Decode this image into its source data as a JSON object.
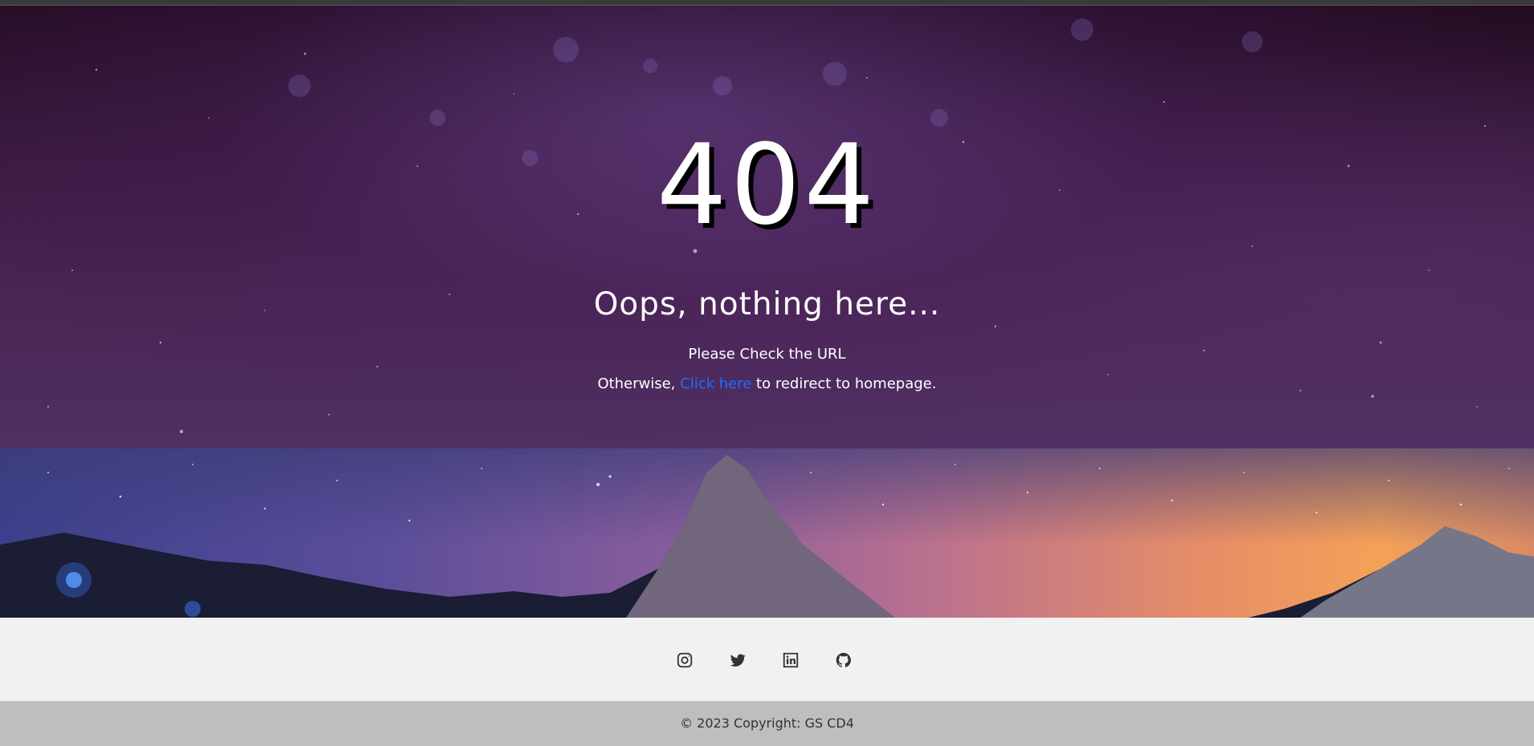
{
  "error": {
    "code": "404",
    "title": "Oops, nothing here...",
    "line1": "Please Check the URL",
    "line2_prefix": "Otherwise, ",
    "link_text": "Click here",
    "line2_suffix": " to redirect to homepage."
  },
  "social": {
    "icons": [
      "instagram-icon",
      "twitter-icon",
      "linkedin-icon",
      "github-icon"
    ]
  },
  "footer": {
    "copyright": "© 2023 Copyright: GS CD4"
  },
  "colors": {
    "link": "#1e6fff",
    "social_bg": "#f1f1f1",
    "footer_bg": "#bebebe",
    "hero_bg": "#3b1a40"
  }
}
